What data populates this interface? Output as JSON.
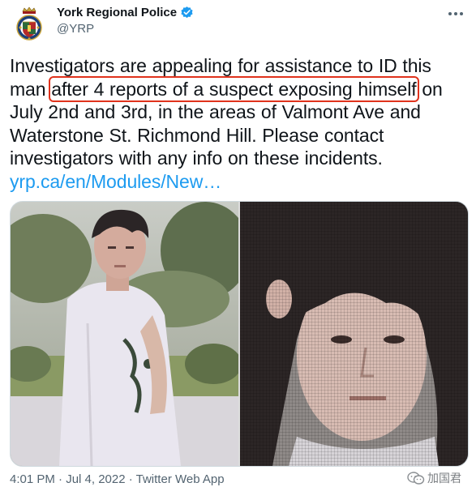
{
  "author": {
    "name": "York Regional Police",
    "handle": "@YRP",
    "avatar_icon": "police-badge-crest-icon",
    "verified_icon": "verified-badge-icon"
  },
  "tweet": {
    "text_before": "Investigators are appealing for assistance to ID this man",
    "text_highlighted": "after 4 reports of a suspect exposing himself",
    "text_after": "on July 2nd and 3rd, in the areas of Valmont Ave and Waterstone St. Richmond Hill. Please contact investigators with any info on these incidents.",
    "link": "yrp.ca/en/Modules/New…"
  },
  "media": {
    "images": [
      {
        "name": "suspect-photo-outdoor"
      },
      {
        "name": "suspect-photo-closeup"
      }
    ]
  },
  "footer": {
    "timestamp": "4:01 PM · Jul 4, 2022 · Twitter Web App"
  },
  "watermark": {
    "text": "加国君",
    "icon": "wechat-logo-icon"
  },
  "colors": {
    "link": "#1d9bf0",
    "highlight_box": "#e0321c",
    "verified": "#1d9bf0",
    "secondary_text": "#536471"
  }
}
